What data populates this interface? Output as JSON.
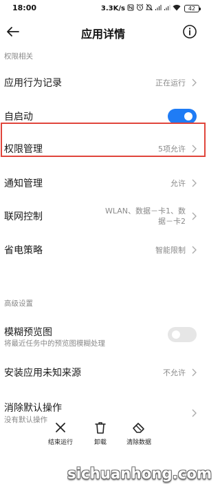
{
  "status_bar": {
    "time": "18:00",
    "net_speed": "3.3K/s",
    "icons": [
      "nfc-icon",
      "alarm-icon",
      "mute-icon",
      "signal-icon",
      "signal-icon-2",
      "wifi-icon"
    ],
    "battery": "42"
  },
  "header": {
    "title": "应用详情",
    "back_icon": "back-arrow-icon",
    "info_icon": "info-icon"
  },
  "sections": {
    "permissions_header": "权限相关",
    "advanced_header": "高级设置"
  },
  "rows": {
    "behavior_record": {
      "label": "应用行为记录",
      "value": "正在运行"
    },
    "autostart": {
      "label": "自启动",
      "toggle": true
    },
    "permission_mgmt": {
      "label": "权限管理",
      "value": "5项允许"
    },
    "notification_mgmt": {
      "label": "通知管理",
      "value": "允许"
    },
    "network_control": {
      "label": "联网控制",
      "value_line1": "WLAN、数据－卡1、数",
      "value_line2": "据－卡2"
    },
    "power_strategy": {
      "label": "省电策略",
      "value": "智能限制"
    },
    "blur_preview": {
      "label": "模糊预览图",
      "sub": "将最近任务中的预览图模糊处理",
      "toggle": false
    },
    "install_unknown": {
      "label": "安装应用未知来源",
      "value": "不允许"
    },
    "clear_defaults": {
      "label": "消除默认操作",
      "sub": "没有默认操作"
    }
  },
  "bottom_bar": {
    "force_stop": "结束运行",
    "uninstall": "卸载",
    "clear_data": "清除数据"
  },
  "colors": {
    "accent": "#1f7cf5",
    "highlight": "#e0443a",
    "secondary_text": "#8a8a8a"
  },
  "watermark": "sichuanhong.com"
}
